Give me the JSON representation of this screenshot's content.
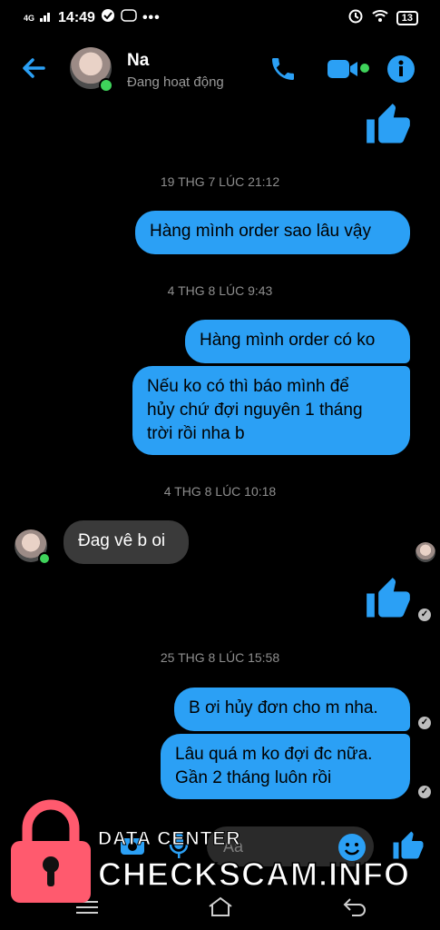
{
  "status": {
    "time": "14:49",
    "network": "4G",
    "battery": "13"
  },
  "header": {
    "name": "Na",
    "subtitle": "Đang hoạt động"
  },
  "messages": [
    {
      "type": "timestamp",
      "text": "19 THG 7 LÚC 21:12"
    },
    {
      "type": "out",
      "text": "Hàng mình order sao lâu vậy"
    },
    {
      "type": "timestamp",
      "text": "4 THG 8 LÚC 9:43"
    },
    {
      "type": "out",
      "text": "Hàng mình order có ko"
    },
    {
      "type": "out",
      "text": "Nếu ko có thì báo mình để\nhủy chứ đợi nguyên 1 tháng\ntrời rồi nha b"
    },
    {
      "type": "timestamp",
      "text": "4 THG 8 LÚC 10:18"
    },
    {
      "type": "in",
      "text": "Đag vê b oi"
    },
    {
      "type": "timestamp",
      "text": "25 THG 8 LÚC 15:58"
    },
    {
      "type": "out",
      "text": "B ơi hủy đơn cho m nha."
    },
    {
      "type": "out",
      "text": "Lâu quá m ko đợi đc nữa.\nGần 2 tháng luôn rồi"
    }
  ],
  "composer": {
    "placeholder": "Aa"
  },
  "watermark": {
    "line1": "DATA CENTER",
    "line2": "CHECKSCAM.INFO"
  },
  "colors": {
    "accent": "#2ba0f5",
    "incoming_bubble": "#3a3a3a",
    "online": "#3fd35b"
  }
}
